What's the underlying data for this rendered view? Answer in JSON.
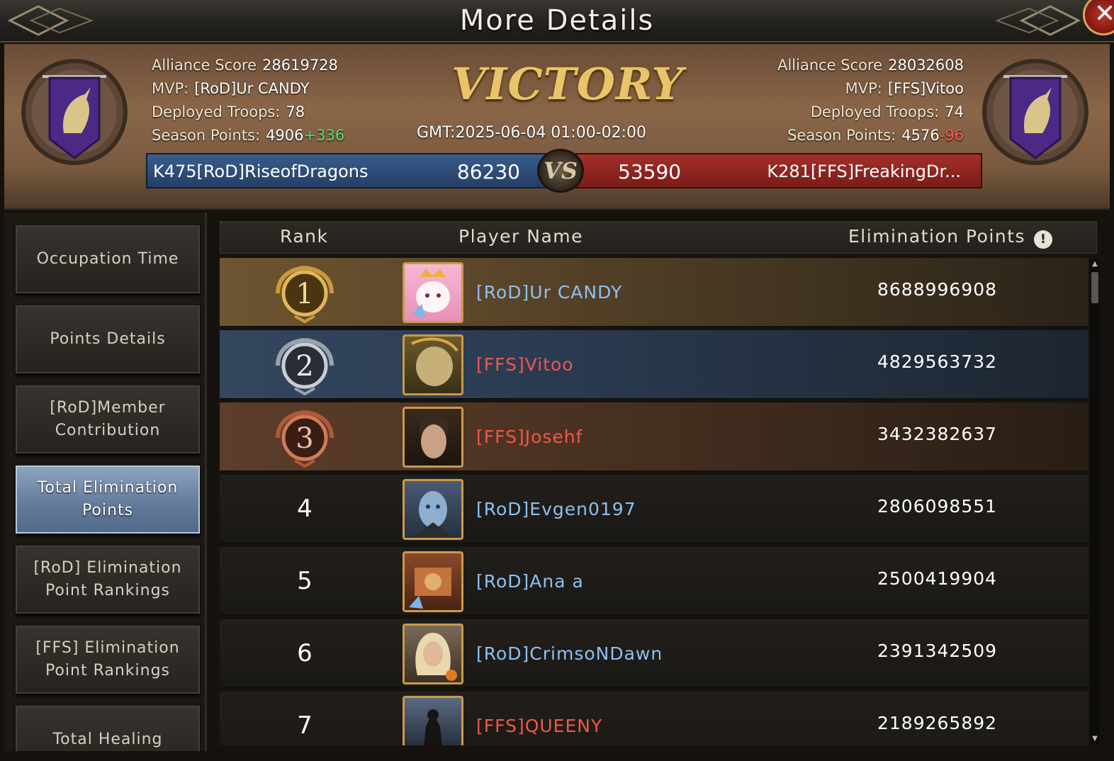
{
  "window": {
    "title": "More Details"
  },
  "header": {
    "result": "VICTORY",
    "time": "GMT:2025-06-04 01:00-02:00",
    "left": {
      "score_label": "Alliance Score",
      "score": "28619728",
      "mvp_label": "MVP:",
      "mvp": "[RoD]Ur CANDY",
      "troops_label": "Deployed Troops:",
      "troops": "78",
      "season_label": "Season Points:",
      "season": "4906",
      "season_delta": "+336",
      "alliance": "K475[RoD]RiseofDragons",
      "battle_score": "86230"
    },
    "right": {
      "score_label": "Alliance Score",
      "score": "28032608",
      "mvp_label": "MVP:",
      "mvp": "[FFS]Vitoo",
      "troops_label": "Deployed Troops:",
      "troops": "74",
      "season_label": "Season Points:",
      "season": "4576",
      "season_delta": "-96",
      "alliance": "K281[FFS]FreakingDr...",
      "battle_score": "53590"
    },
    "vs": "VS"
  },
  "sidebar": {
    "items": [
      {
        "label": "Occupation Time"
      },
      {
        "label": "Points Details"
      },
      {
        "label": "[RoD]Member Contribution"
      },
      {
        "label": "Total Elimination Points",
        "active": true
      },
      {
        "label": "[RoD] Elimination Point Rankings"
      },
      {
        "label": "[FFS] Elimination Point Rankings"
      },
      {
        "label": "Total Healing"
      }
    ]
  },
  "table": {
    "headers": {
      "rank": "Rank",
      "player": "Player Name",
      "points": "Elimination Points"
    },
    "rows": [
      {
        "rank": "1",
        "name": "[RoD]Ur CANDY",
        "points": "8688996908",
        "team": "blue"
      },
      {
        "rank": "2",
        "name": "[FFS]Vitoo",
        "points": "4829563732",
        "team": "red"
      },
      {
        "rank": "3",
        "name": "[FFS]Josehf",
        "points": "3432382637",
        "team": "red"
      },
      {
        "rank": "4",
        "name": "[RoD]Evgen0197",
        "points": "2806098551",
        "team": "blue"
      },
      {
        "rank": "5",
        "name": "[RoD]Ana a",
        "points": "2500419904",
        "team": "blue"
      },
      {
        "rank": "6",
        "name": "[RoD]CrimsoNDawn",
        "points": "2391342509",
        "team": "blue"
      },
      {
        "rank": "7",
        "name": "[FFS]QUEENY",
        "points": "2189265892",
        "team": "red"
      }
    ]
  },
  "colors": {
    "blue_team": "#8ec0f0",
    "red_team": "#f0584a",
    "gold": "#e9c46a",
    "gain": "#5be06a",
    "loss": "#ff5a4a"
  },
  "icons": {
    "close": "close-icon",
    "info": "info-icon",
    "emblem": "unicorn-banner-icon",
    "medals": [
      "gold-medal-icon",
      "silver-medal-icon",
      "bronze-medal-icon"
    ]
  }
}
